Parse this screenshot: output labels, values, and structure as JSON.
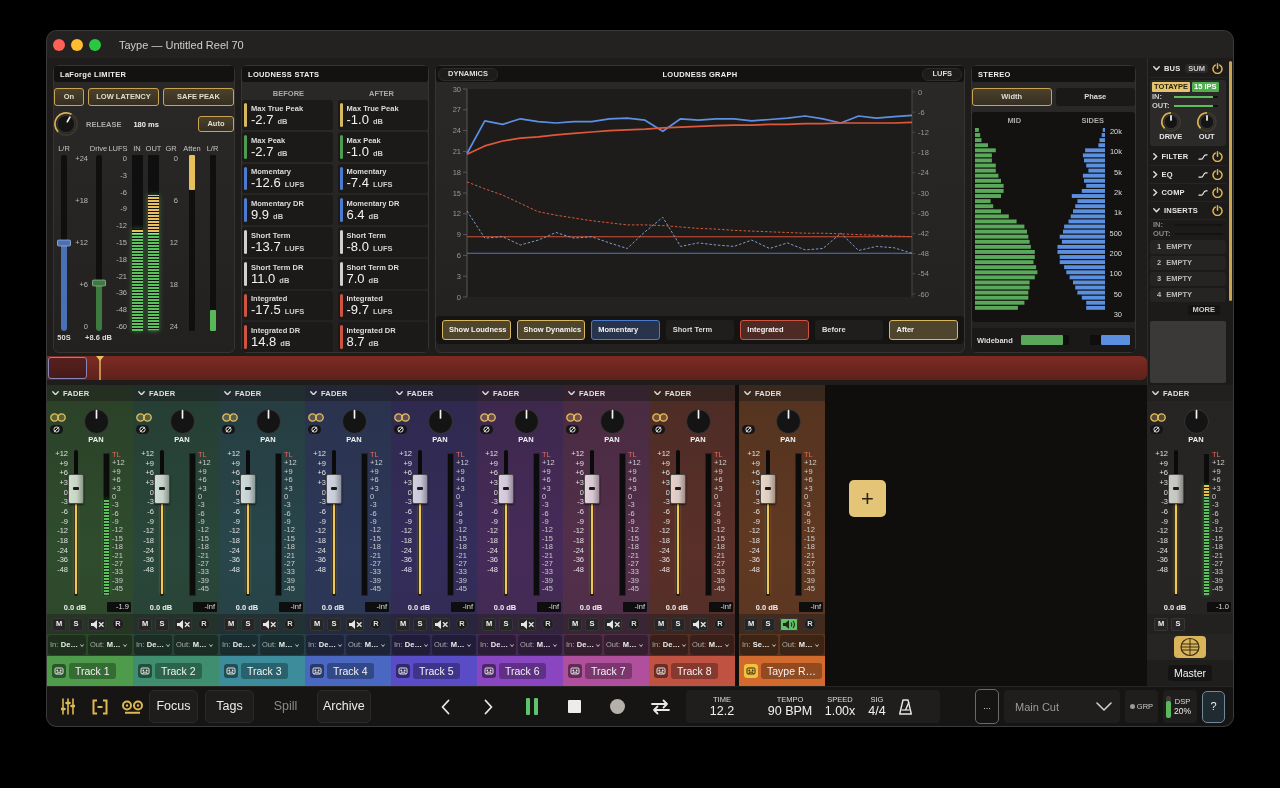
{
  "window": {
    "title": "Taype — Untitled Reel 70"
  },
  "limiter": {
    "title": "LaForgé LIMITER",
    "toggles": [
      {
        "label": "On",
        "selected": true
      },
      {
        "label": "LOW LATENCY",
        "selected": true
      },
      {
        "label": "SAFE PEAK",
        "selected": true
      }
    ],
    "release": {
      "label": "RELEASE",
      "value": "180 ms"
    },
    "auto": {
      "label": "Auto",
      "selected": true
    },
    "balance": {
      "label": "L/R",
      "level": 0.5,
      "value": "50S"
    },
    "drive": {
      "label": "Drive",
      "scale": [
        "+24",
        "+18",
        "+12",
        "+6",
        "0"
      ],
      "level": 0.27,
      "value": "+8.6 dB"
    },
    "lufs_scale": {
      "label": "LUFS",
      "ticks": [
        "0",
        "-3",
        "-6",
        "-9",
        "-12",
        "-15",
        "-18",
        "-21",
        "-36",
        "-48",
        "-60"
      ]
    },
    "meters": [
      {
        "label": "IN",
        "level": 0.58
      },
      {
        "label": "OUT",
        "level": 0.77
      }
    ],
    "gr_scale": {
      "label": "GR",
      "ticks": [
        "0",
        "6",
        "12",
        "18",
        "24"
      ]
    },
    "atten": {
      "label": "Atten",
      "level": 0.2
    },
    "output_meter": {
      "label": "L/R",
      "level": 0.12
    }
  },
  "loudness_stats": {
    "title": "LOUDNESS STATS",
    "columns": [
      {
        "heading": "BEFORE",
        "cards": [
          {
            "label": "Max True Peak",
            "value": "-2.7",
            "unit": "dB",
            "color": "#d8b75e"
          },
          {
            "label": "Max Peak",
            "value": "-2.7",
            "unit": "dB",
            "color": "#4f9b4f"
          },
          {
            "label": "Momentary",
            "value": "-12.6",
            "unit": "LUFS",
            "color": "#4b7bd0"
          },
          {
            "label": "Momentary DR",
            "value": "9.9",
            "unit": "dB",
            "color": "#4b7bd0"
          },
          {
            "label": "Short Term",
            "value": "-13.7",
            "unit": "LUFS",
            "color": "#d0d0d0"
          },
          {
            "label": "Short Term DR",
            "value": "11.0",
            "unit": "dB",
            "color": "#d0d0d0"
          },
          {
            "label": "Integrated",
            "value": "-17.5",
            "unit": "LUFS",
            "color": "#cf5440"
          },
          {
            "label": "Integrated DR",
            "value": "14.8",
            "unit": "dB",
            "color": "#cf5440"
          }
        ]
      },
      {
        "heading": "AFTER",
        "cards": [
          {
            "label": "Max True Peak",
            "value": "-1.0",
            "unit": "dB",
            "color": "#d8b75e"
          },
          {
            "label": "Max Peak",
            "value": "-1.0",
            "unit": "dB",
            "color": "#4f9b4f"
          },
          {
            "label": "Momentary",
            "value": "-7.4",
            "unit": "LUFS",
            "color": "#4b7bd0"
          },
          {
            "label": "Momentary DR",
            "value": "6.4",
            "unit": "dB",
            "color": "#4b7bd0"
          },
          {
            "label": "Short Term",
            "value": "-8.0",
            "unit": "LUFS",
            "color": "#d0d0d0"
          },
          {
            "label": "Short Term DR",
            "value": "7.0",
            "unit": "dB",
            "color": "#d0d0d0"
          },
          {
            "label": "Integrated",
            "value": "-9.7",
            "unit": "LUFS",
            "color": "#cf5440"
          },
          {
            "label": "Integrated DR",
            "value": "8.7",
            "unit": "dB",
            "color": "#cf5440"
          }
        ]
      }
    ]
  },
  "loudness_graph": {
    "title": "LOUDNESS GRAPH",
    "left_tab": "DYNAMICS",
    "right_tab": "LUFS",
    "right_ticks": [
      "0",
      "-6",
      "-12",
      "-18",
      "-24",
      "-30",
      "-36",
      "-42",
      "-48",
      "-54",
      "-60"
    ],
    "chart_data": {
      "type": "line",
      "ylim": [
        0,
        30
      ],
      "yticks": [
        0,
        3,
        6,
        9,
        12,
        15,
        18,
        21,
        24,
        27,
        30
      ],
      "series": [
        {
          "color": "#d0503a",
          "line_style": "solid",
          "values": [
            8.7,
            8.7,
            8.7,
            8.7,
            8.7,
            8.7,
            8.7,
            8.7,
            8.7,
            8.7,
            8.7,
            8.7,
            8.7,
            8.7,
            8.7,
            8.7,
            8.7,
            8.7,
            8.7,
            8.7,
            8.7,
            8.7,
            8.7,
            8.7,
            8.7,
            8.7
          ]
        },
        {
          "color": "#4a78c8",
          "line_style": "solid",
          "values": [
            6.3,
            6.3,
            6.3,
            6.3,
            6.3,
            6.3,
            6.3,
            6.3,
            6.3,
            6.3,
            6.3,
            6.3,
            6.3,
            6.3,
            6.3,
            6.3,
            6.3,
            6.3,
            6.3,
            6.3,
            6.3,
            6.3,
            6.3,
            6.3,
            6.3,
            6.3
          ]
        },
        {
          "color": "#5b90e6",
          "line_style": "solid",
          "values": [
            20.7,
            25.4,
            24.9,
            25.7,
            25.3,
            25.1,
            25.3,
            25.3,
            25.7,
            25.8,
            25.5,
            23.9,
            25.7,
            25.5,
            25.7,
            25.7,
            25.4,
            25.6,
            25.8,
            26.1,
            25.7,
            25.1,
            26.1,
            25.8,
            26.0,
            26.2
          ]
        },
        {
          "color": "#e0583c",
          "line_style": "solid",
          "values": [
            20.6,
            21.8,
            22.5,
            22.9,
            23.1,
            23.4,
            23.6,
            23.8,
            24.0,
            24.1,
            24.2,
            24.4,
            24.5,
            24.6,
            24.7,
            24.8,
            24.8,
            24.9,
            24.9,
            25.0,
            25.0,
            25.1,
            25.1,
            25.1,
            25.1,
            25.2
          ]
        },
        {
          "color": "#d8583e",
          "line_style": "dashed",
          "values": [
            16.6,
            15.6,
            14.7,
            13.5,
            12.3,
            11.8,
            11.4,
            11.0,
            10.7,
            10.4,
            10.4,
            10.3,
            10.1,
            9.9,
            9.8,
            9.6,
            9.5,
            9.4,
            9.3,
            9.2,
            9.2,
            9.1,
            9.0,
            8.9,
            8.8,
            8.7
          ]
        },
        {
          "color": "#7f9ccc",
          "line_style": "dashed",
          "values": [
            12.4,
            8.5,
            8.7,
            7.5,
            8.2,
            9.3,
            8.5,
            8.7,
            7.8,
            7.0,
            9.4,
            11.5,
            7.3,
            7.8,
            7.5,
            7.3,
            8.2,
            7.0,
            7.8,
            6.8,
            7.0,
            9.2,
            6.7,
            7.3,
            7.1,
            6.3
          ]
        }
      ]
    },
    "toggles": [
      {
        "label": "Show Loudness",
        "selected": true,
        "color": "#d8b75e"
      },
      {
        "label": "Show Dynamics",
        "selected": true,
        "color": "#d8b75e"
      },
      {
        "label": "Momentary",
        "selected": true,
        "color": "#4b7bd0"
      },
      {
        "label": "Short Term",
        "selected": false
      },
      {
        "label": "Integrated",
        "selected": true,
        "color": "#cf5440"
      },
      {
        "label": "Before",
        "selected": false
      },
      {
        "label": "After",
        "selected": true,
        "color": "#d8b75e"
      }
    ]
  },
  "stereo": {
    "title": "STEREO",
    "tabs": [
      {
        "label": "Width",
        "selected": true
      },
      {
        "label": "Phase",
        "selected": false
      }
    ],
    "mid_label": "MID",
    "sides_label": "SIDES",
    "freq_labels": [
      "20k",
      "10k",
      "5k",
      "2k",
      "1k",
      "500",
      "200",
      "100",
      "50",
      "30"
    ],
    "wideband": {
      "label": "Wideband",
      "meters": [
        {
          "level": 0.88,
          "color": "#5aa85a"
        },
        {
          "level": 0.73,
          "color": "#5b8fe0"
        }
      ]
    }
  },
  "bus": {
    "title": "BUS",
    "expanded": true,
    "on": true,
    "sum_button": "SUM",
    "badges": [
      {
        "text": "TOTAYPE",
        "color": "#e6c46a"
      },
      {
        "text": "15 IPS",
        "color": "#4fb050"
      }
    ],
    "meters": [
      {
        "label": "IN:",
        "level": 0.88
      },
      {
        "label": "OUT:",
        "level": 0.88
      }
    ],
    "knobs": [
      {
        "label": "DRIVE"
      },
      {
        "label": "OUT"
      }
    ],
    "sections": [
      {
        "title": "FILTER",
        "expanded": false,
        "on": true
      },
      {
        "title": "EQ",
        "expanded": false,
        "on": true
      },
      {
        "title": "COMP",
        "expanded": false,
        "on": true
      }
    ],
    "inserts": {
      "title": "INSERTS",
      "expanded": true,
      "on": true,
      "io": [
        "IN:",
        "OUT:"
      ],
      "slots": [
        {
          "number": "1",
          "label": "EMPTY"
        },
        {
          "number": "2",
          "label": "EMPTY"
        },
        {
          "number": "3",
          "label": "EMPTY"
        },
        {
          "number": "4",
          "label": "EMPTY"
        }
      ],
      "more_button": "MORE"
    }
  },
  "timeline": {
    "loop_region": {
      "level": 0.035
    },
    "playhead": {
      "level": 0.048
    }
  },
  "mixer": {
    "strips": [
      {
        "kind": "track",
        "header": "FADER",
        "color": "#4d9b4b",
        "linked": true,
        "pan": {
          "label": "PAN"
        },
        "fader_scale": [
          "+12",
          "+9",
          "+6",
          "+3",
          "0",
          "-3",
          "-6",
          "-9",
          "-12",
          "-18",
          "-24",
          "-36",
          "-48"
        ],
        "meter_scale": [
          "TL",
          "+12",
          "+9",
          "+6",
          "+3",
          "0",
          "-3",
          "-6",
          "-9",
          "-12",
          "-15",
          "-18",
          "-21",
          "-27",
          "-33",
          "-39",
          "-45"
        ],
        "fader": {
          "level": 0.73,
          "value": "0.0 dB"
        },
        "meter": {
          "level": 0.68,
          "reading": "-1.9"
        },
        "buttons": [
          "M",
          "S"
        ],
        "monitor_on": false,
        "record": "R",
        "input": {
          "label": "In:",
          "value": "De…"
        },
        "output": {
          "label": "Out:",
          "value": "M…"
        },
        "name": "Track 1"
      },
      {
        "kind": "track",
        "header": "FADER",
        "color": "#3e8e6f",
        "linked": true,
        "pan": {
          "label": "PAN"
        },
        "fader_scale": [
          "+12",
          "+9",
          "+6",
          "+3",
          "0",
          "-3",
          "-6",
          "-9",
          "-12",
          "-18",
          "-24",
          "-36",
          "-48"
        ],
        "meter_scale": [
          "TL",
          "+12",
          "+9",
          "+6",
          "+3",
          "0",
          "-3",
          "-6",
          "-9",
          "-12",
          "-15",
          "-18",
          "-21",
          "-27",
          "-33",
          "-39",
          "-45"
        ],
        "fader": {
          "level": 0.73,
          "value": "0.0 dB"
        },
        "meter": {
          "reading": "-inf"
        },
        "buttons": [
          "M",
          "S"
        ],
        "monitor_on": false,
        "record": "R",
        "input": {
          "label": "In:",
          "value": "De…"
        },
        "output": {
          "label": "Out:",
          "value": "M…"
        },
        "name": "Track 2"
      },
      {
        "kind": "track",
        "header": "FADER",
        "color": "#3c8c9c",
        "linked": true,
        "pan": {
          "label": "PAN"
        },
        "fader_scale": [
          "+12",
          "+9",
          "+6",
          "+3",
          "0",
          "-3",
          "-6",
          "-9",
          "-12",
          "-18",
          "-24",
          "-36",
          "-48"
        ],
        "meter_scale": [
          "TL",
          "+12",
          "+9",
          "+6",
          "+3",
          "0",
          "-3",
          "-6",
          "-9",
          "-12",
          "-15",
          "-18",
          "-21",
          "-27",
          "-33",
          "-39",
          "-45"
        ],
        "fader": {
          "level": 0.73,
          "value": "0.0 dB"
        },
        "meter": {
          "reading": "-inf"
        },
        "buttons": [
          "M",
          "S"
        ],
        "monitor_on": false,
        "record": "R",
        "input": {
          "label": "In:",
          "value": "De…"
        },
        "output": {
          "label": "Out:",
          "value": "M…"
        },
        "name": "Track 3"
      },
      {
        "kind": "track",
        "header": "FADER",
        "color": "#4a68c2",
        "linked": true,
        "pan": {
          "label": "PAN"
        },
        "fader_scale": [
          "+12",
          "+9",
          "+6",
          "+3",
          "0",
          "-3",
          "-6",
          "-9",
          "-12",
          "-18",
          "-24",
          "-36",
          "-48"
        ],
        "meter_scale": [
          "TL",
          "+12",
          "+9",
          "+6",
          "+3",
          "0",
          "-3",
          "-6",
          "-9",
          "-12",
          "-15",
          "-18",
          "-21",
          "-27",
          "-33",
          "-39",
          "-45"
        ],
        "fader": {
          "level": 0.73,
          "value": "0.0 dB"
        },
        "meter": {
          "reading": "-inf"
        },
        "buttons": [
          "M",
          "S"
        ],
        "monitor_on": false,
        "record": "R",
        "input": {
          "label": "In:",
          "value": "De…"
        },
        "output": {
          "label": "Out:",
          "value": "M…"
        },
        "name": "Track 4"
      },
      {
        "kind": "track",
        "header": "FADER",
        "color": "#5a4bc6",
        "linked": true,
        "pan": {
          "label": "PAN"
        },
        "fader_scale": [
          "+12",
          "+9",
          "+6",
          "+3",
          "0",
          "-3",
          "-6",
          "-9",
          "-12",
          "-18",
          "-24",
          "-36",
          "-48"
        ],
        "meter_scale": [
          "TL",
          "+12",
          "+9",
          "+6",
          "+3",
          "0",
          "-3",
          "-6",
          "-9",
          "-12",
          "-15",
          "-18",
          "-21",
          "-27",
          "-33",
          "-39",
          "-45"
        ],
        "fader": {
          "level": 0.73,
          "value": "0.0 dB"
        },
        "meter": {
          "reading": "-inf"
        },
        "buttons": [
          "M",
          "S"
        ],
        "monitor_on": false,
        "record": "R",
        "input": {
          "label": "In:",
          "value": "De…"
        },
        "output": {
          "label": "Out:",
          "value": "M…"
        },
        "name": "Track 5"
      },
      {
        "kind": "track",
        "header": "FADER",
        "color": "#8a46c0",
        "linked": true,
        "pan": {
          "label": "PAN"
        },
        "fader_scale": [
          "+12",
          "+9",
          "+6",
          "+3",
          "0",
          "-3",
          "-6",
          "-9",
          "-12",
          "-18",
          "-24",
          "-36",
          "-48"
        ],
        "meter_scale": [
          "TL",
          "+12",
          "+9",
          "+6",
          "+3",
          "0",
          "-3",
          "-6",
          "-9",
          "-12",
          "-15",
          "-18",
          "-21",
          "-27",
          "-33",
          "-39",
          "-45"
        ],
        "fader": {
          "level": 0.73,
          "value": "0.0 dB"
        },
        "meter": {
          "reading": "-inf"
        },
        "buttons": [
          "M",
          "S"
        ],
        "monitor_on": false,
        "record": "R",
        "input": {
          "label": "In:",
          "value": "De…"
        },
        "output": {
          "label": "Out:",
          "value": "M…"
        },
        "name": "Track 6"
      },
      {
        "kind": "track",
        "header": "FADER",
        "color": "#b04f9c",
        "linked": true,
        "pan": {
          "label": "PAN"
        },
        "fader_scale": [
          "+12",
          "+9",
          "+6",
          "+3",
          "0",
          "-3",
          "-6",
          "-9",
          "-12",
          "-18",
          "-24",
          "-36",
          "-48"
        ],
        "meter_scale": [
          "TL",
          "+12",
          "+9",
          "+6",
          "+3",
          "0",
          "-3",
          "-6",
          "-9",
          "-12",
          "-15",
          "-18",
          "-21",
          "-27",
          "-33",
          "-39",
          "-45"
        ],
        "fader": {
          "level": 0.73,
          "value": "0.0 dB"
        },
        "meter": {
          "reading": "-inf"
        },
        "buttons": [
          "M",
          "S"
        ],
        "monitor_on": false,
        "record": "R",
        "input": {
          "label": "In:",
          "value": "De…"
        },
        "output": {
          "label": "Out:",
          "value": "M…"
        },
        "name": "Track 7"
      },
      {
        "kind": "track",
        "header": "FADER",
        "color": "#c05242",
        "linked": true,
        "pan": {
          "label": "PAN"
        },
        "fader_scale": [
          "+12",
          "+9",
          "+6",
          "+3",
          "0",
          "-3",
          "-6",
          "-9",
          "-12",
          "-18",
          "-24",
          "-36",
          "-48"
        ],
        "meter_scale": [
          "TL",
          "+12",
          "+9",
          "+6",
          "+3",
          "0",
          "-3",
          "-6",
          "-9",
          "-12",
          "-15",
          "-18",
          "-21",
          "-27",
          "-33",
          "-39",
          "-45"
        ],
        "fader": {
          "level": 0.73,
          "value": "0.0 dB"
        },
        "meter": {
          "reading": "-inf"
        },
        "buttons": [
          "M",
          "S"
        ],
        "monitor_on": false,
        "record": "R",
        "input": {
          "label": "In:",
          "value": "De…"
        },
        "output": {
          "label": "Out:",
          "value": "M…"
        },
        "name": "Track 8"
      },
      {
        "kind": "return",
        "header": "FADER",
        "color": "#d26a2e",
        "linked": false,
        "pan": {
          "label": "PAN"
        },
        "fader_scale": [
          "+12",
          "+9",
          "+6",
          "+3",
          "0",
          "-3",
          "-6",
          "-9",
          "-12",
          "-18",
          "-24",
          "-36",
          "-48"
        ],
        "meter_scale": [
          "TL",
          "+12",
          "+9",
          "+6",
          "+3",
          "0",
          "-3",
          "-6",
          "-9",
          "-12",
          "-15",
          "-18",
          "-21",
          "-27",
          "-33",
          "-39",
          "-45"
        ],
        "fader": {
          "level": 0.73,
          "value": "0.0 dB"
        },
        "meter": {
          "reading": "-inf"
        },
        "buttons": [
          "M",
          "S"
        ],
        "monitor_on": true,
        "record": "R",
        "input": {
          "label": "In:",
          "value": "Se…"
        },
        "output": {
          "label": "Out:",
          "value": "M…"
        },
        "name": "Taype R…"
      }
    ],
    "add_button": "+"
  },
  "master_strip": {
    "kind": "master",
    "header": "FADER",
    "linked": true,
    "pan": {
      "label": "PAN"
    },
    "fader_scale": [
      "+12",
      "+9",
      "+6",
      "+3",
      "0",
      "-3",
      "-6",
      "-9",
      "-12",
      "-18",
      "-24",
      "-36",
      "-48"
    ],
    "meter_scale": [
      "TL",
      "+12",
      "+9",
      "+6",
      "+3",
      "0",
      "-3",
      "-6",
      "-9",
      "-12",
      "-15",
      "-18",
      "-21",
      "-27",
      "-33",
      "-39",
      "-45"
    ],
    "fader": {
      "level": 0.73,
      "value": "0.0 dB"
    },
    "meter": {
      "level": 0.78,
      "reading": "-1.0"
    },
    "buttons": [
      "M",
      "S"
    ],
    "name": "Master"
  },
  "toolbar": {
    "views": [
      {
        "label": "Focus",
        "disabled": false
      },
      {
        "label": "Tags",
        "disabled": false
      },
      {
        "label": "Spill",
        "disabled": true
      },
      {
        "label": "Archive",
        "disabled": false
      }
    ],
    "transport": {
      "playing": true
    },
    "info": [
      {
        "label": "TIME",
        "value": "12.2"
      },
      {
        "label": "TEMPO",
        "value": "90 BPM"
      },
      {
        "label": "SPEED",
        "value": "1.00x"
      },
      {
        "label": "SIG",
        "value": "4/4"
      }
    ],
    "more_button": "...",
    "cut_select": {
      "value": "Main Cut"
    },
    "group_button": "GRP",
    "dsp": {
      "label": "DSP",
      "value": "20%",
      "level": 0.75
    },
    "help_button": "?"
  }
}
